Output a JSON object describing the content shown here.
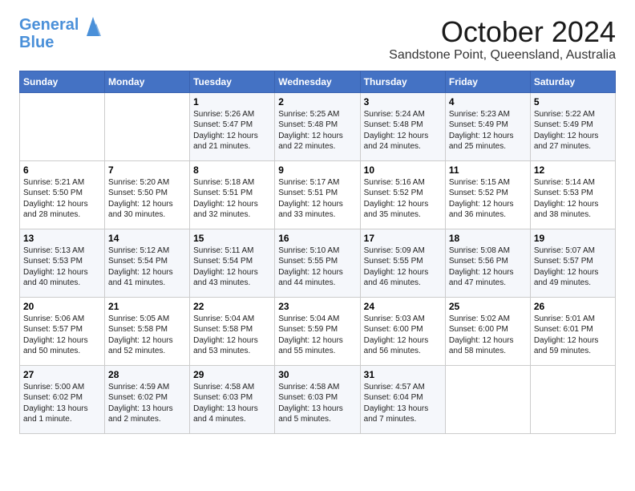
{
  "logo": {
    "line1": "General",
    "line2": "Blue"
  },
  "title": {
    "month": "October 2024",
    "location": "Sandstone Point, Queensland, Australia"
  },
  "weekdays": [
    "Sunday",
    "Monday",
    "Tuesday",
    "Wednesday",
    "Thursday",
    "Friday",
    "Saturday"
  ],
  "weeks": [
    [
      {
        "day": "",
        "info": ""
      },
      {
        "day": "",
        "info": ""
      },
      {
        "day": "1",
        "info": "Sunrise: 5:26 AM\nSunset: 5:47 PM\nDaylight: 12 hours and 21 minutes."
      },
      {
        "day": "2",
        "info": "Sunrise: 5:25 AM\nSunset: 5:48 PM\nDaylight: 12 hours and 22 minutes."
      },
      {
        "day": "3",
        "info": "Sunrise: 5:24 AM\nSunset: 5:48 PM\nDaylight: 12 hours and 24 minutes."
      },
      {
        "day": "4",
        "info": "Sunrise: 5:23 AM\nSunset: 5:49 PM\nDaylight: 12 hours and 25 minutes."
      },
      {
        "day": "5",
        "info": "Sunrise: 5:22 AM\nSunset: 5:49 PM\nDaylight: 12 hours and 27 minutes."
      }
    ],
    [
      {
        "day": "6",
        "info": "Sunrise: 5:21 AM\nSunset: 5:50 PM\nDaylight: 12 hours and 28 minutes."
      },
      {
        "day": "7",
        "info": "Sunrise: 5:20 AM\nSunset: 5:50 PM\nDaylight: 12 hours and 30 minutes."
      },
      {
        "day": "8",
        "info": "Sunrise: 5:18 AM\nSunset: 5:51 PM\nDaylight: 12 hours and 32 minutes."
      },
      {
        "day": "9",
        "info": "Sunrise: 5:17 AM\nSunset: 5:51 PM\nDaylight: 12 hours and 33 minutes."
      },
      {
        "day": "10",
        "info": "Sunrise: 5:16 AM\nSunset: 5:52 PM\nDaylight: 12 hours and 35 minutes."
      },
      {
        "day": "11",
        "info": "Sunrise: 5:15 AM\nSunset: 5:52 PM\nDaylight: 12 hours and 36 minutes."
      },
      {
        "day": "12",
        "info": "Sunrise: 5:14 AM\nSunset: 5:53 PM\nDaylight: 12 hours and 38 minutes."
      }
    ],
    [
      {
        "day": "13",
        "info": "Sunrise: 5:13 AM\nSunset: 5:53 PM\nDaylight: 12 hours and 40 minutes."
      },
      {
        "day": "14",
        "info": "Sunrise: 5:12 AM\nSunset: 5:54 PM\nDaylight: 12 hours and 41 minutes."
      },
      {
        "day": "15",
        "info": "Sunrise: 5:11 AM\nSunset: 5:54 PM\nDaylight: 12 hours and 43 minutes."
      },
      {
        "day": "16",
        "info": "Sunrise: 5:10 AM\nSunset: 5:55 PM\nDaylight: 12 hours and 44 minutes."
      },
      {
        "day": "17",
        "info": "Sunrise: 5:09 AM\nSunset: 5:55 PM\nDaylight: 12 hours and 46 minutes."
      },
      {
        "day": "18",
        "info": "Sunrise: 5:08 AM\nSunset: 5:56 PM\nDaylight: 12 hours and 47 minutes."
      },
      {
        "day": "19",
        "info": "Sunrise: 5:07 AM\nSunset: 5:57 PM\nDaylight: 12 hours and 49 minutes."
      }
    ],
    [
      {
        "day": "20",
        "info": "Sunrise: 5:06 AM\nSunset: 5:57 PM\nDaylight: 12 hours and 50 minutes."
      },
      {
        "day": "21",
        "info": "Sunrise: 5:05 AM\nSunset: 5:58 PM\nDaylight: 12 hours and 52 minutes."
      },
      {
        "day": "22",
        "info": "Sunrise: 5:04 AM\nSunset: 5:58 PM\nDaylight: 12 hours and 53 minutes."
      },
      {
        "day": "23",
        "info": "Sunrise: 5:04 AM\nSunset: 5:59 PM\nDaylight: 12 hours and 55 minutes."
      },
      {
        "day": "24",
        "info": "Sunrise: 5:03 AM\nSunset: 6:00 PM\nDaylight: 12 hours and 56 minutes."
      },
      {
        "day": "25",
        "info": "Sunrise: 5:02 AM\nSunset: 6:00 PM\nDaylight: 12 hours and 58 minutes."
      },
      {
        "day": "26",
        "info": "Sunrise: 5:01 AM\nSunset: 6:01 PM\nDaylight: 12 hours and 59 minutes."
      }
    ],
    [
      {
        "day": "27",
        "info": "Sunrise: 5:00 AM\nSunset: 6:02 PM\nDaylight: 13 hours and 1 minute."
      },
      {
        "day": "28",
        "info": "Sunrise: 4:59 AM\nSunset: 6:02 PM\nDaylight: 13 hours and 2 minutes."
      },
      {
        "day": "29",
        "info": "Sunrise: 4:58 AM\nSunset: 6:03 PM\nDaylight: 13 hours and 4 minutes."
      },
      {
        "day": "30",
        "info": "Sunrise: 4:58 AM\nSunset: 6:03 PM\nDaylight: 13 hours and 5 minutes."
      },
      {
        "day": "31",
        "info": "Sunrise: 4:57 AM\nSunset: 6:04 PM\nDaylight: 13 hours and 7 minutes."
      },
      {
        "day": "",
        "info": ""
      },
      {
        "day": "",
        "info": ""
      }
    ]
  ]
}
